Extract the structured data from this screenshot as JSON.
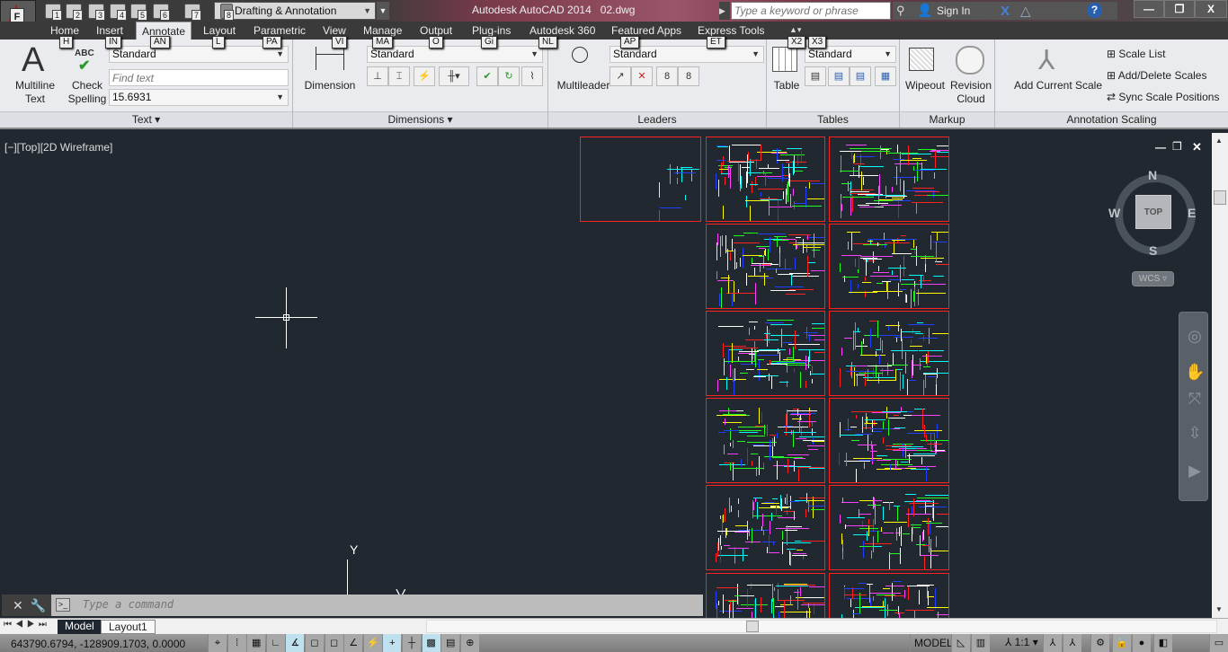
{
  "app": {
    "title": "Autodesk AutoCAD 2014",
    "file": "02.dwg",
    "app_button_key": "F"
  },
  "quick_access": {
    "keys": [
      "1",
      "2",
      "3",
      "4",
      "5",
      "6",
      "7",
      "8"
    ],
    "workspace": "Drafting & Annotation"
  },
  "search": {
    "placeholder": "Type a keyword or phrase"
  },
  "account": {
    "sign_in": "Sign In"
  },
  "window_controls": {
    "minimize": "—",
    "restore": "❐",
    "close": "X"
  },
  "ribbon_tabs": [
    {
      "label": "Home",
      "key": "H"
    },
    {
      "label": "Insert",
      "key": "IN"
    },
    {
      "label": "Annotate",
      "key": "AN",
      "active": true
    },
    {
      "label": "Layout",
      "key": "L"
    },
    {
      "label": "Parametric",
      "key": "PA"
    },
    {
      "label": "View",
      "key": "VI"
    },
    {
      "label": "Manage",
      "key": "MA"
    },
    {
      "label": "Output",
      "key": "O"
    },
    {
      "label": "Plug-ins",
      "key": "Gi"
    },
    {
      "label": "Autodesk 360",
      "key": "NL"
    },
    {
      "label": "Featured Apps",
      "key": "AP"
    },
    {
      "label": "Express Tools",
      "key": "ET"
    }
  ],
  "extra_keys": [
    "X2",
    "X3"
  ],
  "panels": {
    "text": {
      "label": "Text ▾",
      "multiline": "Multiline\nText",
      "check_spelling": "Check\nSpelling",
      "abc": "ABC",
      "style": "Standard",
      "find_placeholder": "Find text",
      "height": "15.6931"
    },
    "dimensions": {
      "label": "Dimensions ▾",
      "dimension": "Dimension",
      "style": "Standard"
    },
    "leaders": {
      "label": "Leaders",
      "multileader": "Multileader",
      "style": "Standard"
    },
    "tables": {
      "label": "Tables",
      "table": "Table",
      "style": "Standard"
    },
    "markup": {
      "label": "Markup",
      "wipeout": "Wipeout",
      "revision_cloud": "Revision\nCloud"
    },
    "annotation_scaling": {
      "label": "Annotation Scaling",
      "add_current_scale": "Add Current Scale",
      "scale_list": "Scale List",
      "add_delete_scales": "Add/Delete Scales",
      "sync_scale_positions": "Sync Scale Positions"
    }
  },
  "viewport": {
    "label": "[−][Top][2D Wireframe]",
    "ucs_y": "Y",
    "viewcube": {
      "top": "TOP",
      "n": "N",
      "s": "S",
      "e": "E",
      "w": "W",
      "wcs": "WCS ▿"
    }
  },
  "command": {
    "placeholder": "Type a command"
  },
  "layout_tabs": [
    "Model",
    "Layout1"
  ],
  "status": {
    "coords": "643790.6794, -128909.1703, 0.0000",
    "model": "MODEL",
    "scale": "1:1 ▾"
  },
  "colors": {
    "viewport_bg": "#212830",
    "sheet_border": "#ff2020",
    "ribbon_bg": "#e9ebee",
    "toggle_on": "#bfe0ee"
  }
}
